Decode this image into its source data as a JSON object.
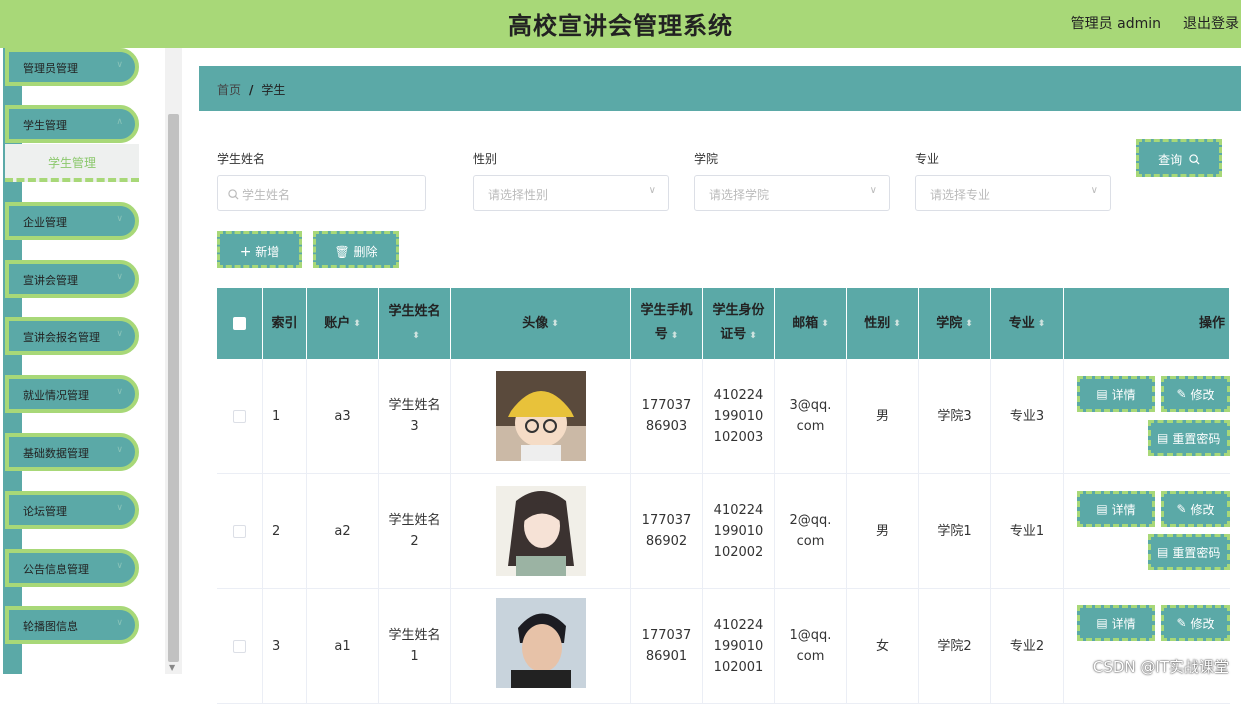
{
  "header": {
    "title": "高校宣讲会管理系统",
    "user": "管理员 admin",
    "logout": "退出登录"
  },
  "sidebar": {
    "items": [
      {
        "label": "管理员管理"
      },
      {
        "label": "学生管理"
      },
      {
        "label": "企业管理"
      },
      {
        "label": "宣讲会管理"
      },
      {
        "label": "宣讲会报名管理"
      },
      {
        "label": "就业情况管理"
      },
      {
        "label": "基础数据管理"
      },
      {
        "label": "论坛管理"
      },
      {
        "label": "公告信息管理"
      },
      {
        "label": "轮播图信息"
      }
    ],
    "active_sub": "学生管理"
  },
  "breadcrumb": {
    "home": "首页",
    "sep": "/",
    "current": "学生"
  },
  "filters": {
    "name": {
      "label": "学生姓名",
      "placeholder": "学生姓名"
    },
    "gender": {
      "label": "性别",
      "placeholder": "请选择性别"
    },
    "college": {
      "label": "学院",
      "placeholder": "请选择学院"
    },
    "major": {
      "label": "专业",
      "placeholder": "请选择专业"
    },
    "query_label": "查询"
  },
  "actions": {
    "add_label": "新增",
    "delete_label": "删除"
  },
  "table": {
    "headers": {
      "index": "索引",
      "account": "账户",
      "name": "学生姓名",
      "avatar": "头像",
      "phone": "学生手机号",
      "idcard": "学生身份证号",
      "email": "邮箱",
      "gender": "性别",
      "college": "学院",
      "major": "专业",
      "ops": "操作"
    },
    "rows": [
      {
        "index": "1",
        "account": "a3",
        "name": "学生姓名3",
        "phone": "17703786903",
        "idcard": "410224199010102003",
        "email": "3@qq.com",
        "gender": "男",
        "college": "学院3",
        "major": "专业3"
      },
      {
        "index": "2",
        "account": "a2",
        "name": "学生姓名2",
        "phone": "17703786902",
        "idcard": "410224199010102002",
        "email": "2@qq.com",
        "gender": "男",
        "college": "学院1",
        "major": "专业1"
      },
      {
        "index": "3",
        "account": "a1",
        "name": "学生姓名1",
        "phone": "17703786901",
        "idcard": "410224199010102001",
        "email": "1@qq.com",
        "gender": "女",
        "college": "学院2",
        "major": "专业2"
      }
    ],
    "row_actions": {
      "detail": "详情",
      "edit": "修改",
      "reset": "重置密码"
    }
  },
  "watermark": "CSDN @IT实战课堂"
}
